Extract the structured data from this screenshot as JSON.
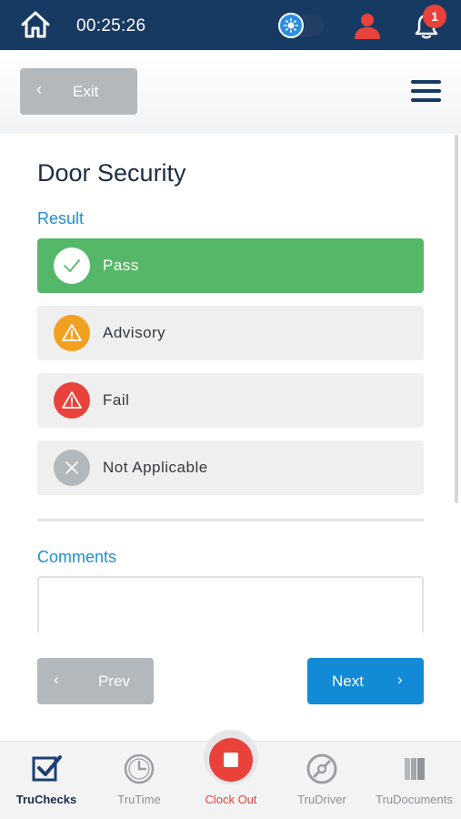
{
  "status_bar": {
    "timer": "00:25:26",
    "notification_count": "1",
    "colors": {
      "background": "#173a63",
      "toggle_knob": "#2a8de0",
      "user_icon": "#e8423b",
      "badge": "#e8423b"
    },
    "icons": [
      "home-icon",
      "sun-toggle-icon",
      "user-icon",
      "bell-icon"
    ]
  },
  "header": {
    "exit_label": "Exit",
    "menu_icon": "hamburger-menu-icon"
  },
  "main": {
    "title": "Door Security",
    "result_label": "Result",
    "options": [
      {
        "label": "Pass",
        "icon": "check-icon",
        "selected": true,
        "color": "#55b868"
      },
      {
        "label": "Advisory",
        "icon": "warning-icon",
        "selected": false,
        "color": "#f2a01f"
      },
      {
        "label": "Fail",
        "icon": "warning-icon",
        "selected": false,
        "color": "#e8423b"
      },
      {
        "label": "Not Applicable",
        "icon": "x-icon",
        "selected": false,
        "color": "#b3b8bd"
      }
    ],
    "comments_label": "Comments",
    "comments_value": ""
  },
  "nav": {
    "prev_label": "Prev",
    "next_label": "Next"
  },
  "tabbar": {
    "tabs": [
      {
        "label": "TruChecks",
        "icon": "checkbox-icon",
        "active": true
      },
      {
        "label": "TruTime",
        "icon": "clock-icon",
        "active": false
      },
      {
        "label": "Clock Out",
        "icon": "stop-icon",
        "active": false
      },
      {
        "label": "TruDriver",
        "icon": "steering-wheel-icon",
        "active": false
      },
      {
        "label": "TruDocuments",
        "icon": "documents-icon",
        "active": false
      }
    ]
  }
}
